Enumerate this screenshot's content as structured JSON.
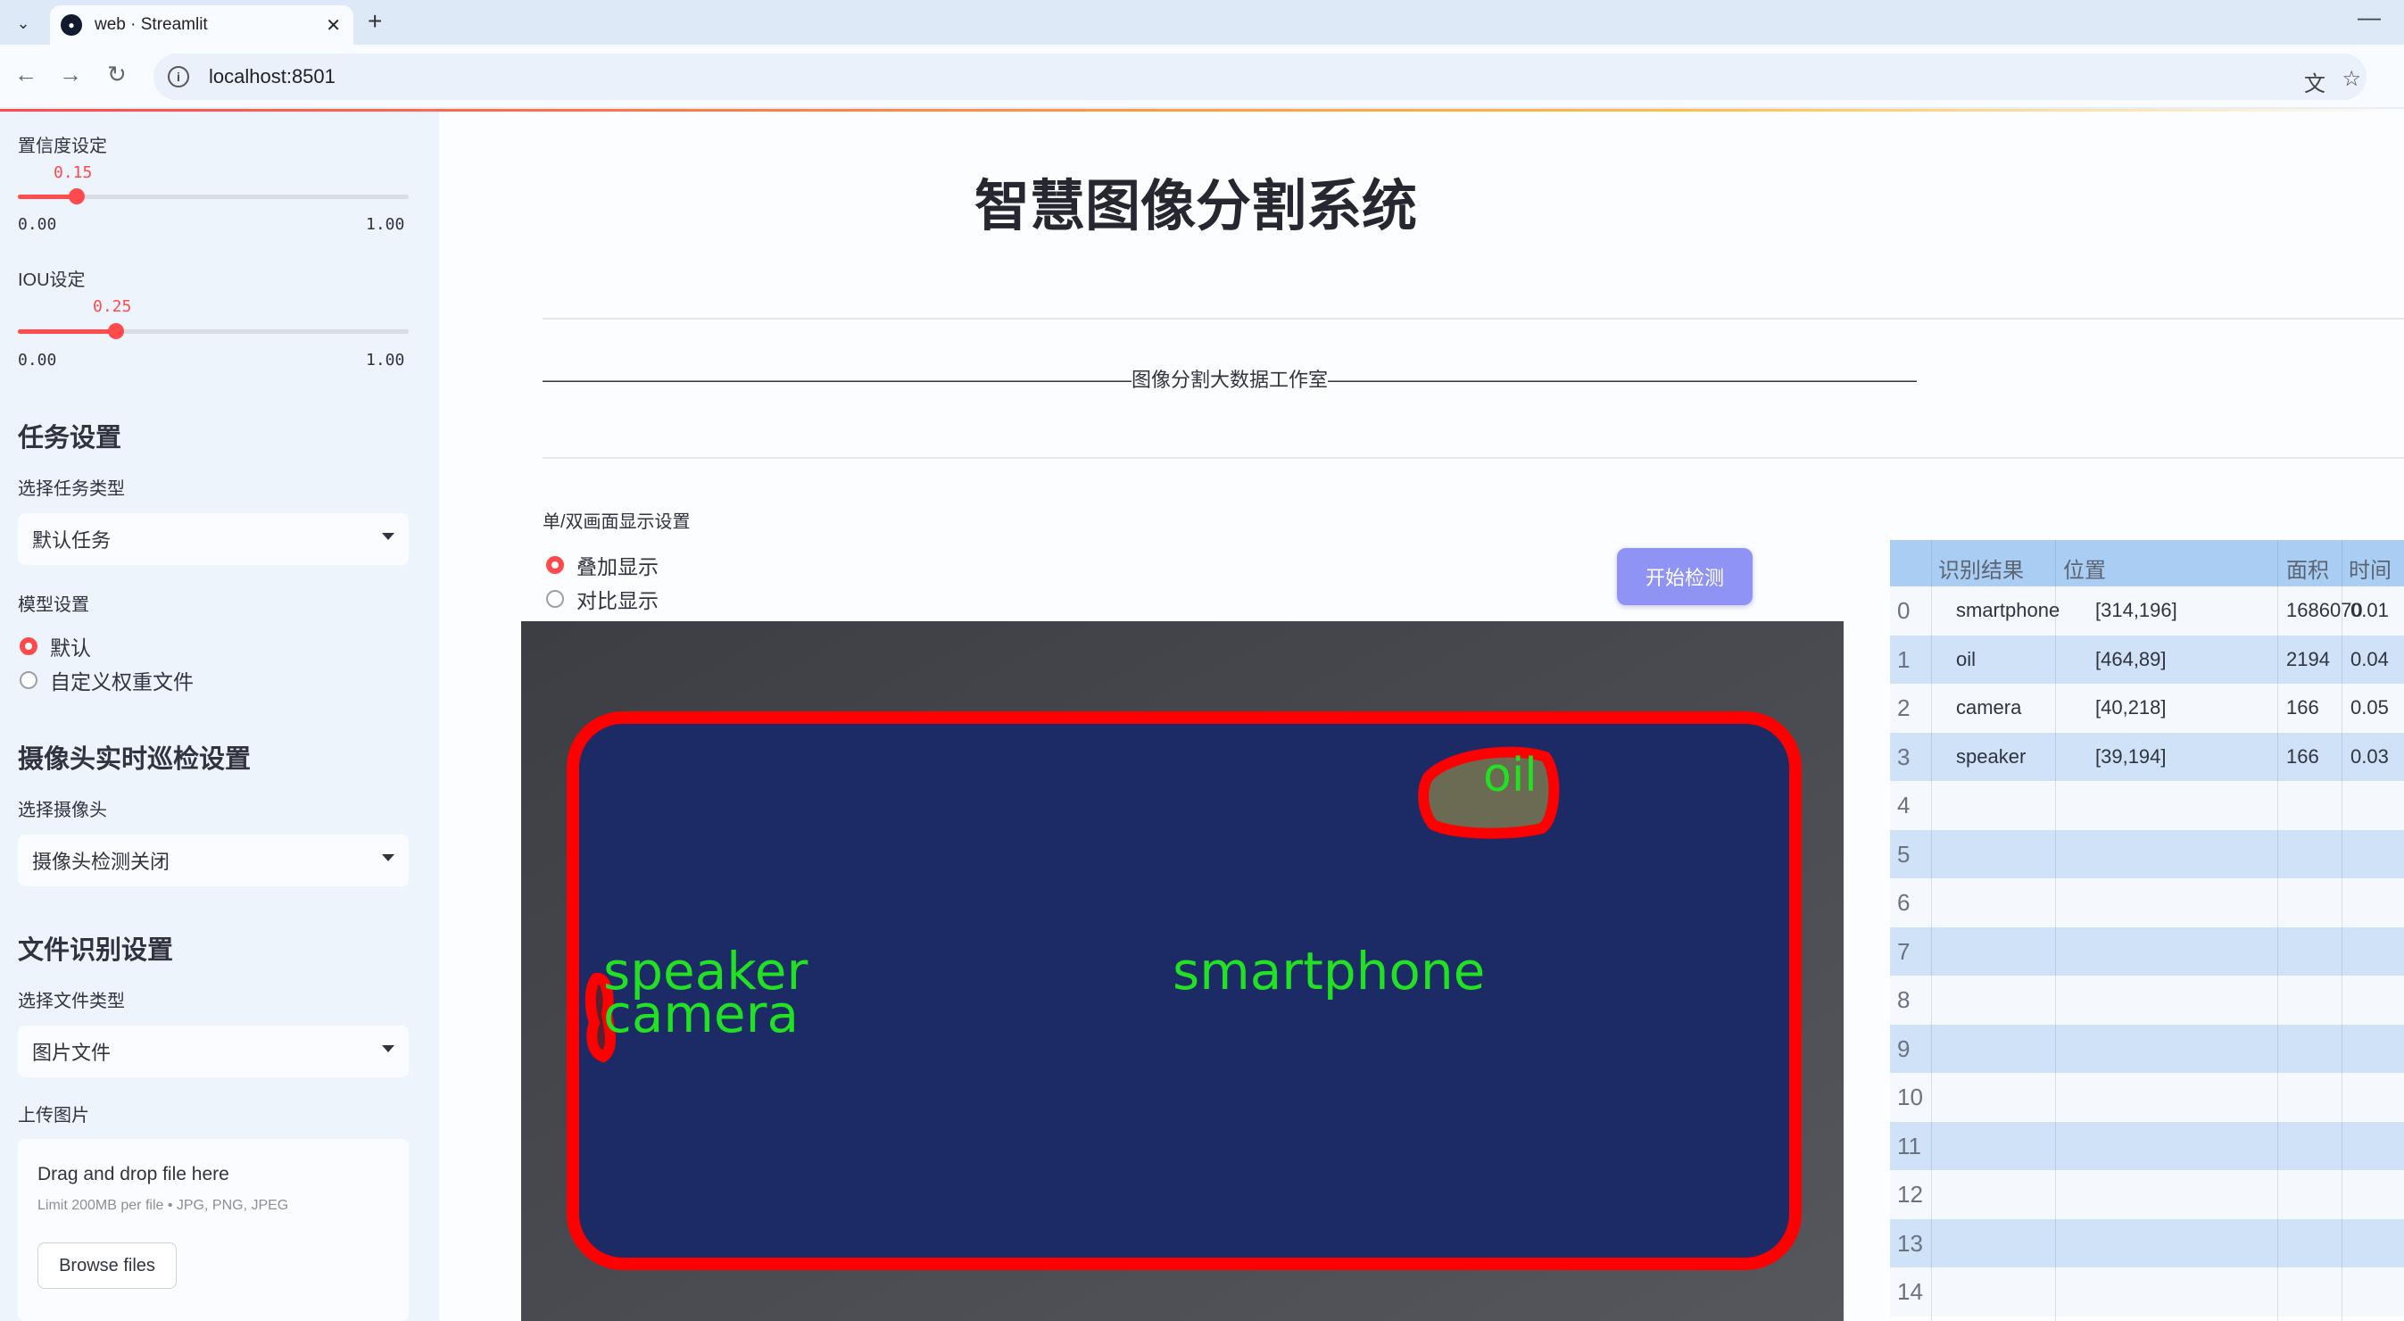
{
  "browser": {
    "tab_title": "web · Streamlit",
    "url": "localhost:8501"
  },
  "sidebar": {
    "confidence": {
      "label": "置信度设定",
      "value": "0.15",
      "min": "0.00",
      "max": "1.00",
      "fraction": 0.15
    },
    "iou": {
      "label": "IOU设定",
      "value": "0.25",
      "min": "0.00",
      "max": "1.00",
      "fraction": 0.25
    },
    "task_heading": "任务设置",
    "task_type_label": "选择任务类型",
    "task_type_value": "默认任务",
    "model_label": "模型设置",
    "model_options": [
      "默认",
      "自定义权重文件"
    ],
    "model_selected": "默认",
    "camera_heading": "摄像头实时巡检设置",
    "camera_label": "选择摄像头",
    "camera_value": "摄像头检测关闭",
    "file_heading": "文件识别设置",
    "file_type_label": "选择文件类型",
    "file_type_value": "图片文件",
    "upload_label": "上传图片",
    "uploader": {
      "title": "Drag and drop file here",
      "subtitle": "Limit 200MB per file • JPG, PNG, JPEG",
      "button": "Browse files"
    }
  },
  "main": {
    "title": "智慧图像分割系统",
    "divider_text": "——————————————————————————————图像分割大数据工作室——————————————————————————————",
    "display_mode_label": "单/双画面显示设置",
    "display_options": [
      "叠加显示",
      "对比显示"
    ],
    "display_selected": "叠加显示",
    "start_button": "开始检测",
    "image_labels": {
      "smartphone": "smartphone",
      "oil": "oil",
      "speaker": "speaker",
      "camera": "camera"
    }
  },
  "results_table": {
    "headers": [
      "识别结果",
      "位置",
      "面积",
      "时间"
    ],
    "rows": [
      {
        "idx": "0",
        "result": "smartphone",
        "pos": "[314,196]",
        "area": "1686070",
        "time": "0.01"
      },
      {
        "idx": "1",
        "result": "oil",
        "pos": "[464,89]",
        "area": "2194",
        "time": "0.04"
      },
      {
        "idx": "2",
        "result": "camera",
        "pos": "[40,218]",
        "area": "166",
        "time": "0.05"
      },
      {
        "idx": "3",
        "result": "speaker",
        "pos": "[39,194]",
        "area": "166",
        "time": "0.03"
      },
      {
        "idx": "4",
        "result": "",
        "pos": "",
        "area": "",
        "time": ""
      },
      {
        "idx": "5",
        "result": "",
        "pos": "",
        "area": "",
        "time": ""
      },
      {
        "idx": "6",
        "result": "",
        "pos": "",
        "area": "",
        "time": ""
      },
      {
        "idx": "7",
        "result": "",
        "pos": "",
        "area": "",
        "time": ""
      },
      {
        "idx": "8",
        "result": "",
        "pos": "",
        "area": "",
        "time": ""
      },
      {
        "idx": "9",
        "result": "",
        "pos": "",
        "area": "",
        "time": ""
      },
      {
        "idx": "10",
        "result": "",
        "pos": "",
        "area": "",
        "time": ""
      },
      {
        "idx": "11",
        "result": "",
        "pos": "",
        "area": "",
        "time": ""
      },
      {
        "idx": "12",
        "result": "",
        "pos": "",
        "area": "",
        "time": ""
      },
      {
        "idx": "13",
        "result": "",
        "pos": "",
        "area": "",
        "time": ""
      },
      {
        "idx": "14",
        "result": "",
        "pos": "",
        "area": "",
        "time": ""
      }
    ]
  },
  "colors": {
    "accent": "#ff4b4b",
    "button": "#8f93f3",
    "mask_fill": "#1c2a66",
    "mask_outline": "#ff0000",
    "label_text": "#22e022"
  }
}
